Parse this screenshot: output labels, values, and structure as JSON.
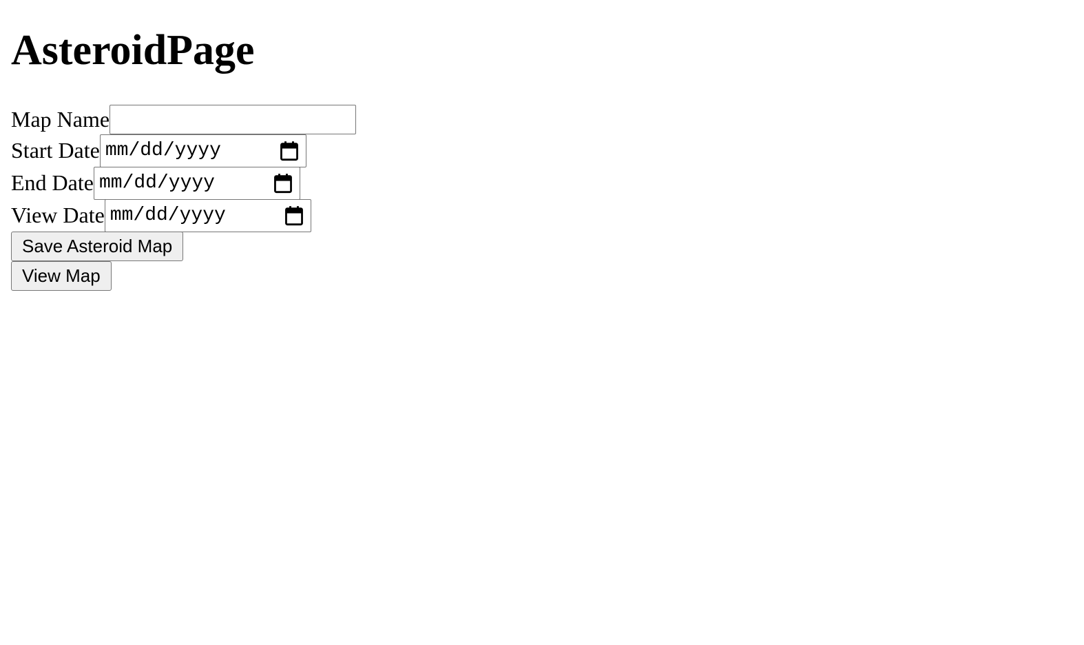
{
  "page": {
    "title": "AsteroidPage"
  },
  "form": {
    "map_name": {
      "label": "Map Name",
      "value": ""
    },
    "start_date": {
      "label": "Start Date",
      "placeholder": "mm/dd/yyyy",
      "icon": "calendar-icon"
    },
    "end_date": {
      "label": "End Date",
      "placeholder": "mm/dd/yyyy",
      "icon": "calendar-icon"
    },
    "view_date": {
      "label": "View Date",
      "placeholder": "mm/dd/yyyy",
      "icon": "calendar-icon"
    }
  },
  "buttons": {
    "save_label": "Save Asteroid Map",
    "view_label": "View Map"
  },
  "colors": {
    "background": "#ffffff",
    "button_bg": "#efefef",
    "border": "#767676"
  }
}
